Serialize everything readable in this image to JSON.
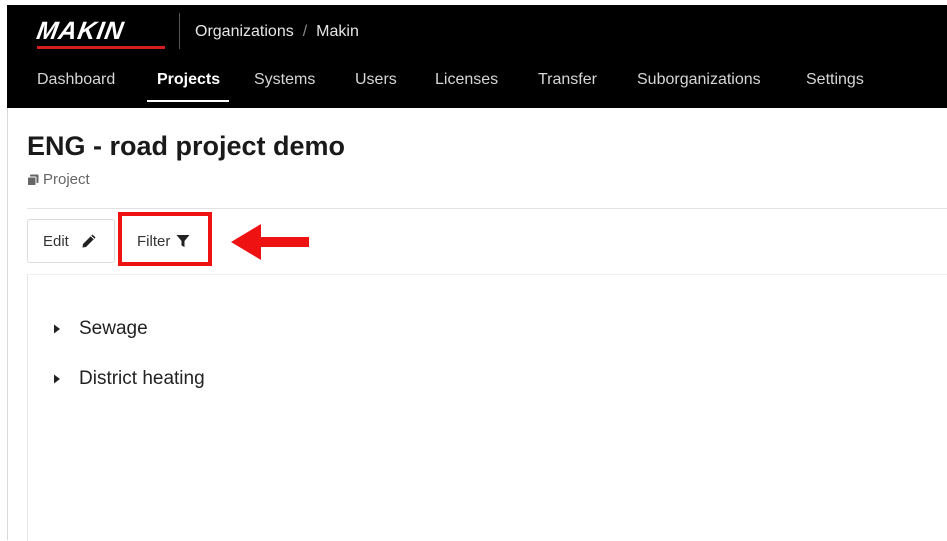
{
  "header": {
    "logo_text": "MAKIN",
    "breadcrumb": [
      "Organizations",
      "Makin"
    ],
    "breadcrumb_separator": "/"
  },
  "nav": {
    "items": [
      {
        "label": "Dashboard"
      },
      {
        "label": "Projects",
        "active": true
      },
      {
        "label": "Systems"
      },
      {
        "label": "Users"
      },
      {
        "label": "Licenses"
      },
      {
        "label": "Transfer"
      },
      {
        "label": "Suborganizations"
      },
      {
        "label": "Settings"
      }
    ]
  },
  "page": {
    "title": "ENG - road project demo",
    "subtitle": "Project",
    "subtitle_icon": "copy-icon"
  },
  "toolbar": {
    "edit_label": "Edit",
    "edit_icon": "pencil-icon",
    "filter_label": "Filter",
    "filter_icon": "funnel-icon"
  },
  "annotation": {
    "highlight_color": "#ee1212",
    "arrow_icon": "arrow-left-icon"
  },
  "tree": {
    "items": [
      {
        "label": "Sewage",
        "icon": "caret-right-icon"
      },
      {
        "label": "District heating",
        "icon": "caret-right-icon"
      }
    ]
  },
  "colors": {
    "header_bg": "#000000",
    "brand_accent": "#d51d1d"
  }
}
